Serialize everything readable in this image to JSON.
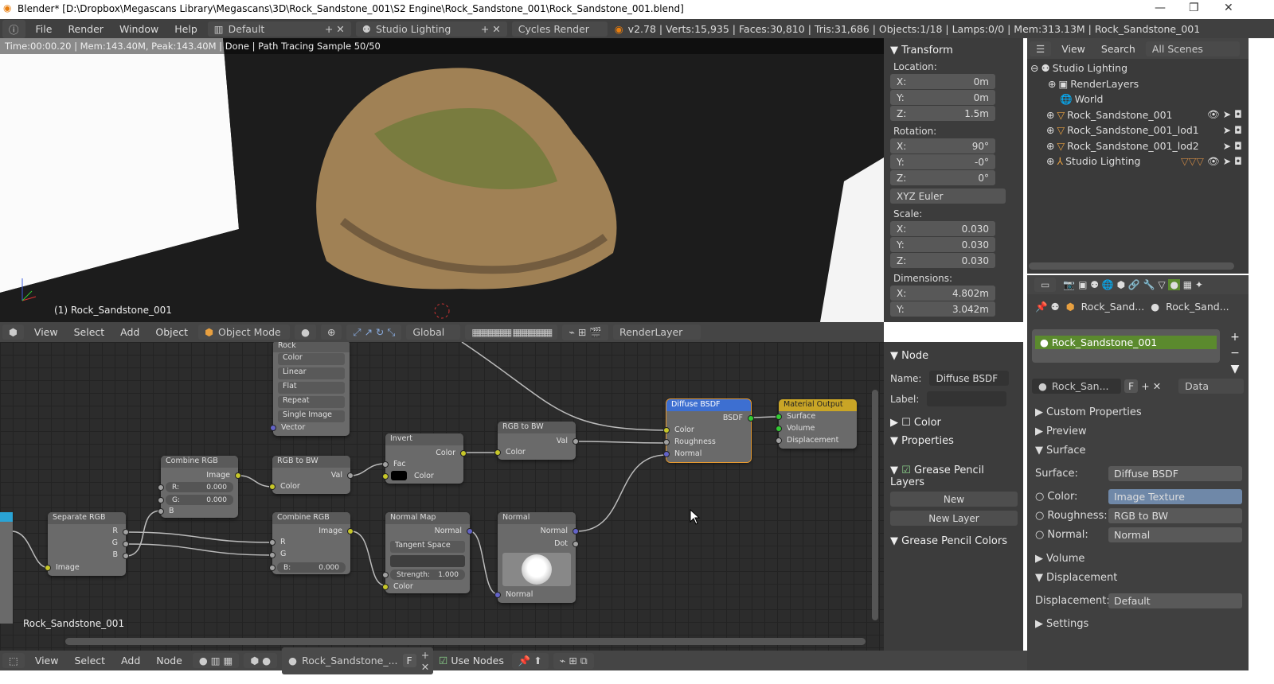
{
  "title": "Blender* [D:\\Dropbox\\Megascans Library\\Megascans\\3D\\Rock_Sandstone_001\\S2 Engine\\Rock_Sandstone_001\\Rock_Sandstone_001.blend]",
  "menu": [
    "File",
    "Render",
    "Window",
    "Help"
  ],
  "screen_layout": "Default",
  "scene": "Studio Lighting",
  "engine": "Cycles Render",
  "stats": "v2.78 | Verts:15,935 | Faces:30,810 | Tris:31,686 | Objects:1/18 | Lamps:0/0 | Mem:313.13M | Rock_Sandstone_001",
  "render_info": "Time:00:00.20 | Mem:143.40M, Peak:143.40M | Done | Path Tracing Sample 50/50",
  "viewport": {
    "object_label": "(1) Rock_Sandstone_001"
  },
  "transform": {
    "title": "Transform",
    "location_label": "Location:",
    "location": [
      [
        "X:",
        "0m"
      ],
      [
        "Y:",
        "0m"
      ],
      [
        "Z:",
        "1.5m"
      ]
    ],
    "rotation_label": "Rotation:",
    "rotation": [
      [
        "X:",
        "90°"
      ],
      [
        "Y:",
        "-0°"
      ],
      [
        "Z:",
        "0°"
      ]
    ],
    "rotation_mode": "XYZ Euler",
    "scale_label": "Scale:",
    "scale": [
      [
        "X:",
        "0.030"
      ],
      [
        "Y:",
        "0.030"
      ],
      [
        "Z:",
        "0.030"
      ]
    ],
    "dimensions_label": "Dimensions:",
    "dimensions": [
      [
        "X:",
        "4.802m"
      ],
      [
        "Y:",
        "3.042m"
      ]
    ]
  },
  "view3d_header": {
    "items": [
      "View",
      "Select",
      "Add",
      "Object"
    ],
    "mode": "Object Mode",
    "orientation": "Global",
    "render_layer": "RenderLayer"
  },
  "outliner": {
    "menu": [
      "View",
      "Search"
    ],
    "filter": "All Scenes",
    "items": [
      "Studio Lighting",
      "RenderLayers",
      "World",
      "Rock_Sandstone_001",
      "Rock_Sandstone_001_lod1",
      "Rock_Sandstone_001_lod2",
      "Studio Lighting"
    ]
  },
  "props": {
    "breadcrumb": [
      "Rock_Sand...",
      "Rock_Sand..."
    ],
    "material_slot": "Rock_Sandstone_001",
    "material_name": "Rock_San...",
    "fake_user": "F",
    "link": "Data",
    "panels": {
      "custom": "Custom Properties",
      "preview": "Preview",
      "surface": "Surface",
      "volume": "Volume",
      "displacement": "Displacement",
      "settings": "Settings"
    },
    "surface": [
      [
        "Surface:",
        "Diffuse BSDF"
      ],
      [
        "Color:",
        "Image Texture"
      ],
      [
        "Roughness:",
        "RGB to BW"
      ],
      [
        "Normal:",
        "Normal"
      ]
    ],
    "displacement": [
      "Displacement:",
      "Default"
    ]
  },
  "node_side": {
    "node_title": "Node",
    "name_label": "Name:",
    "name": "Diffuse BSDF",
    "label_label": "Label:",
    "color": "Color",
    "properties": "Properties",
    "gp_layers": "Grease Pencil Layers",
    "new": "New",
    "new_layer": "New Layer",
    "gp_colors": "Grease Pencil Colors"
  },
  "nodes": {
    "image": {
      "name": "Rock",
      "opts": [
        "Color",
        "Linear",
        "Flat",
        "Repeat",
        "Single Image"
      ],
      "vector": "Vector"
    },
    "combine1": {
      "title": "Combine RGB",
      "out": "Image",
      "r": [
        "R:",
        "0.000"
      ],
      "g": [
        "G:",
        "0.000"
      ],
      "b": "B"
    },
    "rgbbw1": {
      "title": "RGB to BW",
      "out": "Val",
      "in": "Color"
    },
    "invert": {
      "title": "Invert",
      "out": "Color",
      "fac": "Fac",
      "color": "Color"
    },
    "rgbbw2": {
      "title": "RGB to BW",
      "out": "Val",
      "in": "Color"
    },
    "diffuse": {
      "title": "Diffuse BSDF",
      "out": "BSDF",
      "ins": [
        "Color",
        "Roughness",
        "Normal"
      ]
    },
    "output": {
      "title": "Material Output",
      "ins": [
        "Surface",
        "Volume",
        "Displacement"
      ]
    },
    "separate": {
      "title": "Separate RGB",
      "outs": [
        "R",
        "G",
        "B"
      ],
      "in": "Image"
    },
    "combine2": {
      "title": "Combine RGB",
      "out": "Image",
      "r": "R",
      "g": "G",
      "b": [
        "B:",
        "0.000"
      ]
    },
    "normalmap": {
      "title": "Normal Map",
      "out": "Normal",
      "space": "Tangent Space",
      "strength": [
        "Strength:",
        "1.000"
      ],
      "color": "Color"
    },
    "normal": {
      "title": "Normal",
      "outs": [
        "Normal",
        "Dot"
      ],
      "in": "Normal"
    },
    "frame_label": "Rock_Sandstone_001"
  },
  "node_header": {
    "items": [
      "View",
      "Select",
      "Add",
      "Node"
    ],
    "material": "Rock_Sandstone_...",
    "fake": "F",
    "use_nodes": "Use Nodes"
  },
  "colors": {
    "accent_green": "#5b8a2e",
    "selected_node": "#e69a31",
    "diffuse_header": "#3d6fd1",
    "output_header": "#c9a526"
  }
}
